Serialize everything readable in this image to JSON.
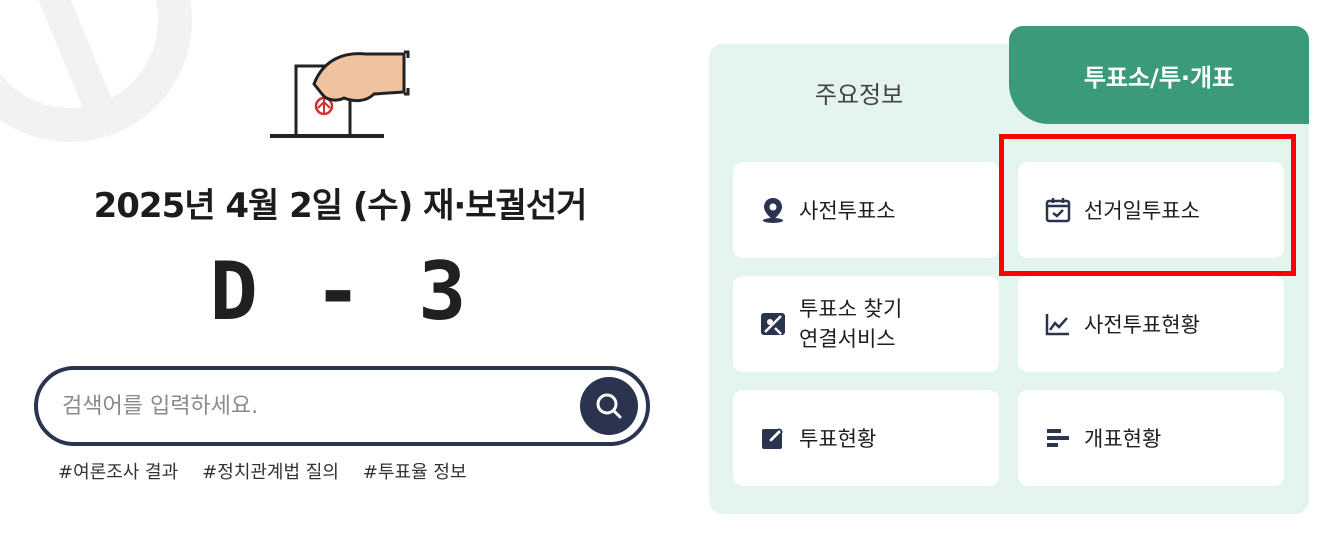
{
  "election": {
    "title": "2025년 4월 2일 (수) 재·보궐선거",
    "dday": "D - 3"
  },
  "search": {
    "placeholder": "검색어를 입력하세요.",
    "value": ""
  },
  "hashtags": [
    "#여론조사 결과",
    "#정치관계법 질의",
    "#투표율 정보"
  ],
  "tabs": {
    "info": "주요정보",
    "polling": "투표소/투·개표"
  },
  "cards": {
    "early_polling": "사전투표소",
    "election_day_polling": "선거일투표소",
    "find_service_line1": "투표소 찾기",
    "find_service_line2": "연결서비스",
    "early_vote_status": "사전투표현황",
    "vote_status": "투표현황",
    "count_status": "개표현황"
  },
  "colors": {
    "navy": "#2b344f",
    "green": "#3a9a7a",
    "panel_bg": "#e4f4ee",
    "highlight": "#ff0000"
  }
}
